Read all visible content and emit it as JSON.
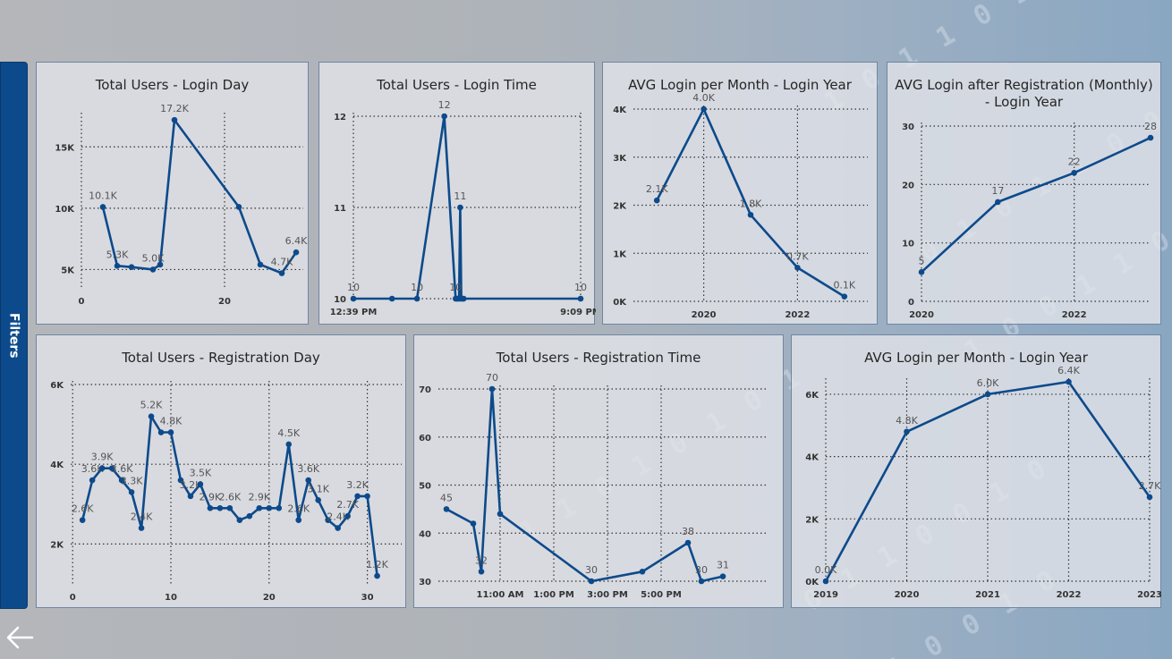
{
  "filters_label": "Filters",
  "colors": {
    "series": "#0d4a8b",
    "panel_border": "#6f86a3",
    "filters_bar": "#0d4a8b"
  },
  "icons": {
    "back": "arrow-left-icon"
  },
  "chart_data": [
    {
      "id": "c1",
      "type": "line",
      "title": "Total Users - Login Day",
      "x": [
        3,
        5,
        7,
        10,
        11,
        13,
        22,
        25,
        28,
        30
      ],
      "values": [
        10100,
        5300,
        5200,
        5000,
        5400,
        17200,
        10100,
        5400,
        4700,
        6400
      ],
      "labels": [
        "10.1K",
        "5.3K",
        "",
        "5.0K",
        "",
        "17.2K",
        "",
        "",
        "4.7K",
        "6.4K"
      ],
      "xlim": [
        0,
        31
      ],
      "ylim": [
        3500,
        17500
      ],
      "xticks": [
        {
          "v": 0,
          "t": "0"
        },
        {
          "v": 20,
          "t": "20"
        }
      ],
      "yticks": [
        {
          "v": 5000,
          "t": "5K"
        },
        {
          "v": 10000,
          "t": "10K"
        },
        {
          "v": 15000,
          "t": "15K"
        }
      ],
      "grid": true
    },
    {
      "id": "c2",
      "type": "line",
      "title": "Total Users - Login Time",
      "x": [
        0,
        0.17,
        0.28,
        0.4,
        0.45,
        0.455,
        0.46,
        0.465,
        0.47,
        0.475,
        0.48,
        0.485,
        1
      ],
      "values": [
        10,
        10,
        10,
        12,
        10,
        10,
        10,
        10,
        11,
        10,
        10,
        10,
        10
      ],
      "labels": [
        "10",
        "",
        "10",
        "12",
        "10",
        "",
        "",
        "",
        "11",
        "",
        "",
        "",
        "10"
      ],
      "xlim": [
        0,
        1
      ],
      "ylim": [
        10,
        12
      ],
      "xticks": [
        {
          "v": 0,
          "t": "12:39 PM"
        },
        {
          "v": 1,
          "t": "9:09 PM"
        }
      ],
      "yticks": [
        {
          "v": 10,
          "t": "10"
        },
        {
          "v": 11,
          "t": "11"
        },
        {
          "v": 12,
          "t": "12"
        }
      ],
      "grid": true
    },
    {
      "id": "c3",
      "type": "line",
      "title": "AVG Login per Month - Login Year",
      "x": [
        2019,
        2020,
        2021,
        2022,
        2023
      ],
      "values": [
        2100,
        4000,
        1800,
        700,
        100
      ],
      "labels": [
        "2.1K",
        "4.0K",
        "1.8K",
        "0.7K",
        "0.1K"
      ],
      "xlim": [
        2018.5,
        2023.5
      ],
      "ylim": [
        0,
        4000
      ],
      "xticks": [
        {
          "v": 2020,
          "t": "2020"
        },
        {
          "v": 2022,
          "t": "2022"
        }
      ],
      "yticks": [
        {
          "v": 0,
          "t": "0K"
        },
        {
          "v": 1000,
          "t": "1K"
        },
        {
          "v": 2000,
          "t": "2K"
        },
        {
          "v": 3000,
          "t": "3K"
        },
        {
          "v": 4000,
          "t": "4K"
        }
      ],
      "grid": true
    },
    {
      "id": "c4",
      "type": "line",
      "title": "AVG Login after Registration (Monthly) - Login Year",
      "x": [
        2020,
        2021,
        2022,
        2023
      ],
      "values": [
        5,
        17,
        22,
        28
      ],
      "labels": [
        "5",
        "17",
        "22",
        "28"
      ],
      "xlim": [
        2020,
        2023
      ],
      "ylim": [
        0,
        30
      ],
      "xticks": [
        {
          "v": 2020,
          "t": "2020"
        },
        {
          "v": 2022,
          "t": "2022"
        }
      ],
      "yticks": [
        {
          "v": 0,
          "t": "0"
        },
        {
          "v": 10,
          "t": "10"
        },
        {
          "v": 20,
          "t": "20"
        },
        {
          "v": 30,
          "t": "30"
        }
      ],
      "grid": true
    },
    {
      "id": "c5",
      "type": "line",
      "title": "Total Users - Registration Day",
      "x": [
        1,
        2,
        3,
        4,
        5,
        6,
        7,
        8,
        9,
        10,
        11,
        12,
        13,
        14,
        15,
        16,
        17,
        18,
        19,
        20,
        21,
        22,
        23,
        24,
        25,
        26,
        27,
        28,
        29,
        30,
        31
      ],
      "values": [
        2600,
        3600,
        3900,
        3900,
        3600,
        3300,
        2400,
        5200,
        4800,
        4800,
        3600,
        3200,
        3500,
        2900,
        2900,
        2900,
        2600,
        2700,
        2900,
        2900,
        2900,
        4500,
        2600,
        3600,
        3100,
        2600,
        2400,
        2700,
        3200,
        3200,
        1200
      ],
      "labels": [
        "2.6K",
        "3.6K",
        "3.9K",
        "",
        "3.6K",
        "3.3K",
        "2.4K",
        "5.2K",
        "",
        "4.8K",
        "",
        "3.2K",
        "3.5K",
        "2.9K",
        "",
        "2.6K",
        "",
        "",
        "2.9K",
        "",
        "",
        "4.5K",
        "2.6K",
        "3.6K",
        "3.1K",
        "",
        "2.4K",
        "2.7K",
        "3.2K",
        "",
        "1.2K"
      ],
      "xlim": [
        -0.2,
        33.5
      ],
      "ylim": [
        1000,
        6000
      ],
      "xticks": [
        {
          "v": 0,
          "t": "0"
        },
        {
          "v": 10,
          "t": "10"
        },
        {
          "v": 20,
          "t": "20"
        },
        {
          "v": 30,
          "t": "30"
        }
      ],
      "yticks": [
        {
          "v": 2000,
          "t": "2K"
        },
        {
          "v": 4000,
          "t": "4K"
        },
        {
          "v": 6000,
          "t": "6K"
        }
      ],
      "grid": true
    },
    {
      "id": "c6",
      "type": "line",
      "title": "Total Users - Registration Time",
      "x": [
        9.0,
        10.0,
        10.3,
        10.7,
        11.0,
        14.4,
        16.3,
        18.0,
        18.5,
        19.3
      ],
      "values": [
        45,
        42,
        32,
        70,
        44,
        30,
        32,
        38,
        30,
        31
      ],
      "labels": [
        "45",
        "",
        "32",
        "70",
        "",
        "30",
        "",
        "38",
        "30",
        "31"
      ],
      "xlim": [
        8.7,
        21
      ],
      "ylim": [
        30,
        70
      ],
      "xticks": [
        {
          "v": 11,
          "t": "11:00 AM"
        },
        {
          "v": 13,
          "t": "1:00 PM"
        },
        {
          "v": 15,
          "t": "3:00 PM"
        },
        {
          "v": 17,
          "t": "5:00 PM"
        }
      ],
      "yticks": [
        {
          "v": 30,
          "t": "30"
        },
        {
          "v": 40,
          "t": "40"
        },
        {
          "v": 50,
          "t": "50"
        },
        {
          "v": 60,
          "t": "60"
        },
        {
          "v": 70,
          "t": "70"
        }
      ],
      "grid": true
    },
    {
      "id": "c7",
      "type": "line",
      "title": "AVG Login per Month - Login Year",
      "x": [
        2019,
        2020,
        2021,
        2022,
        2023
      ],
      "values": [
        0,
        4800,
        6000,
        6400,
        2700
      ],
      "labels": [
        "0.0K",
        "4.8K",
        "6.0K",
        "6.4K",
        "2.7K"
      ],
      "xlim": [
        2019,
        2023
      ],
      "ylim": [
        0,
        6400
      ],
      "xticks": [
        {
          "v": 2019,
          "t": "2019"
        },
        {
          "v": 2020,
          "t": "2020"
        },
        {
          "v": 2021,
          "t": "2021"
        },
        {
          "v": 2022,
          "t": "2022"
        },
        {
          "v": 2023,
          "t": "2023"
        }
      ],
      "yticks": [
        {
          "v": 0,
          "t": "0K"
        },
        {
          "v": 2000,
          "t": "2K"
        },
        {
          "v": 4000,
          "t": "4K"
        },
        {
          "v": 6000,
          "t": "6K"
        }
      ],
      "grid": true
    }
  ]
}
